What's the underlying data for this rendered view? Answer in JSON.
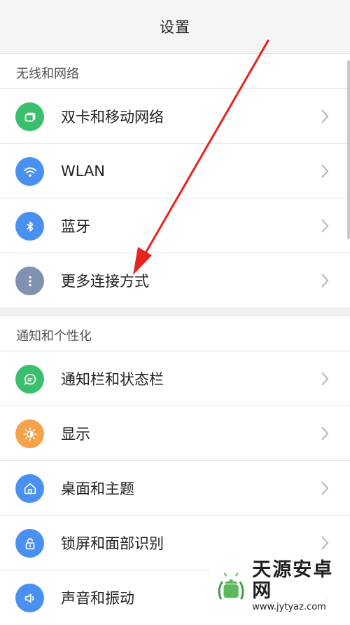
{
  "titlebar": {
    "title": "设置"
  },
  "sections": [
    {
      "header": "无线和网络",
      "items": [
        {
          "label": "双卡和移动网络",
          "icon": "sim-cards-icon",
          "color": "#3bbf6e"
        },
        {
          "label": "WLAN",
          "icon": "wifi-icon",
          "color": "#4a90f0"
        },
        {
          "label": "蓝牙",
          "icon": "bluetooth-icon",
          "color": "#4a90f0"
        },
        {
          "label": "更多连接方式",
          "icon": "more-dots-icon",
          "color": "#8092b0"
        }
      ]
    },
    {
      "header": "通知和个性化",
      "items": [
        {
          "label": "通知栏和状态栏",
          "icon": "chat-bubble-icon",
          "color": "#3bbf6e"
        },
        {
          "label": "显示",
          "icon": "brightness-icon",
          "color": "#f5a24a"
        },
        {
          "label": "桌面和主题",
          "icon": "home-icon",
          "color": "#4a90f0"
        },
        {
          "label": "锁屏和面部识别",
          "icon": "lock-icon",
          "color": "#4a90f0"
        },
        {
          "label": "声音和振动",
          "icon": "speaker-icon",
          "color": "#4a90f0"
        }
      ]
    }
  ],
  "annotation": {
    "color": "#e8231f"
  },
  "watermark": {
    "name": "天源安卓网",
    "url": "www.jytyaz.com"
  }
}
